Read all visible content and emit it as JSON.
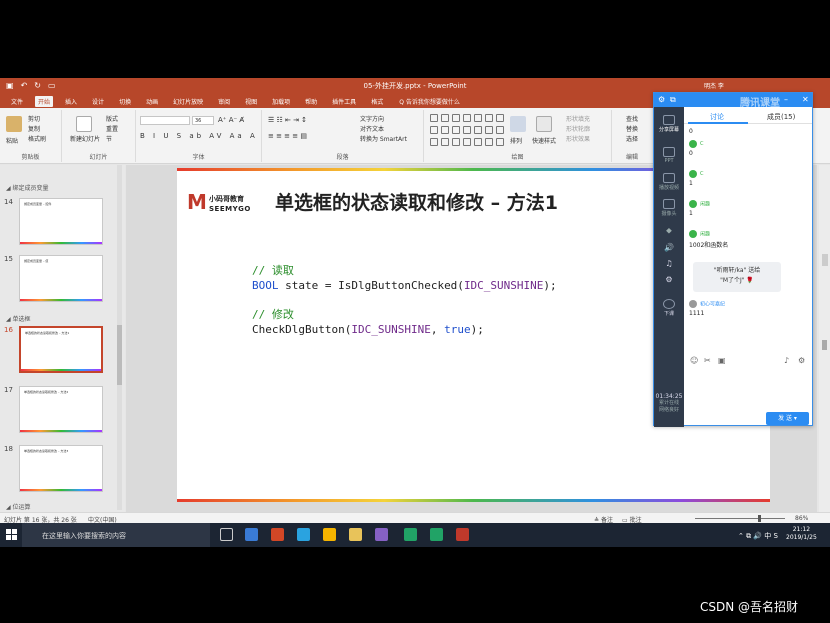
{
  "window": {
    "doc_title": "05-外挂开发.pptx  -  PowerPoint",
    "user": "明杰 李"
  },
  "menu": [
    "文件",
    "开始",
    "插入",
    "设计",
    "切换",
    "动画",
    "幻灯片放映",
    "审阅",
    "视图",
    "加载项",
    "帮助",
    "插件工具",
    "格式",
    "Q 告诉我你想要做什么"
  ],
  "ribbon": {
    "groups": [
      "剪贴板",
      "幻灯片",
      "字体",
      "段落",
      "绘图",
      "编辑"
    ],
    "paste": "粘贴",
    "cut": "剪切",
    "copy": "复制",
    "format_painter": "格式刷",
    "new_slide": "新建幻灯片",
    "layout": "版式",
    "reset": "重置",
    "section": "节",
    "font_size": "36",
    "text_direction": "文字方向",
    "align_text": "对齐文本",
    "smartart": "转换为 SmartArt",
    "arrange": "排列",
    "quick_styles": "快速样式",
    "shape_fill": "形状填充",
    "shape_outline": "形状轮廓",
    "shape_effects": "形状效果",
    "find": "查找",
    "replace": "替换",
    "select": "选择"
  },
  "slides_panel": {
    "sections": [
      "绑定成员变量",
      "单选框",
      "位运算"
    ],
    "thumbs": [
      {
        "num": "14",
        "title": "绑定成员变量 – 控件"
      },
      {
        "num": "15",
        "title": "绑定成员变量 – 值"
      },
      {
        "num": "16",
        "title": "单选框的状态读取和修改 – 方法1"
      },
      {
        "num": "17",
        "title": "单选框的状态读取和修改 – 方法2"
      },
      {
        "num": "18",
        "title": "单选框的状态读取和修改 – 方法3"
      }
    ]
  },
  "slide": {
    "logo_m": "M",
    "logo_cn": "小码哥教育",
    "logo_en": "SEEMYGO",
    "title": "单选框的状态读取和修改 – 方法1",
    "code": {
      "c1": "// 读取",
      "l1_type": "BOOL",
      "l1_rest": " state = IsDlgButtonChecked(",
      "l1_arg": "IDC_SUNSHINE",
      "l1_end": ");",
      "c2": "// 修改",
      "l2_fn": "CheckDlgButton(",
      "l2_arg": "IDC_SUNSHINE",
      "l2_sep": ", ",
      "l2_val": "true",
      "l2_end": ");"
    }
  },
  "statusbar": {
    "slide_info": "幻灯片 第 16 张，共 26 张",
    "lang": "中文(中国)",
    "notes": "备注",
    "comments": "批注",
    "zoom": "86%"
  },
  "taskbar": {
    "search_placeholder": "在这里输入你要搜索的内容",
    "time": "21:12",
    "date": "2019/1/25",
    "ime": "中"
  },
  "tencent": {
    "brand": "腾讯课堂",
    "tab_discuss": "讨论",
    "tab_members": "成员(15)",
    "side": [
      "分享屏幕",
      "PPT",
      "播放视频",
      "摄像头",
      "下课"
    ],
    "timer": "01:34:25",
    "timer_sub": "累计在线",
    "timer_sub2": "网络良好",
    "messages": [
      {
        "name": "",
        "text": "0"
      },
      {
        "name": "C",
        "text": "0"
      },
      {
        "name": "C",
        "text": "1"
      },
      {
        "name": "闲趣",
        "text": "1"
      },
      {
        "name": "闲趣",
        "text": "1002和函数名"
      }
    ],
    "gift_line1": "\"听雨轩/ka\" 送给",
    "gift_line2": "\"M了个J\" 🌹",
    "last_name": "初心可嘉纪",
    "last_text": "1111",
    "send": "发 送"
  },
  "watermark": "CSDN @吾名招财"
}
